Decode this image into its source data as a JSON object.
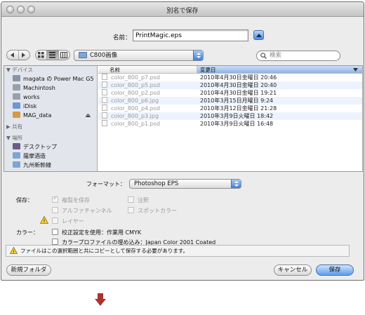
{
  "window": {
    "title": "別名で保存"
  },
  "name": {
    "label": "名前：",
    "value": "PrintMagic.eps"
  },
  "toolbar": {
    "location": "C800画像",
    "search_placeholder": "検索"
  },
  "sidebar": {
    "sections": [
      {
        "title": "デバイス",
        "items": [
          {
            "label": "magata の Power Mac G5",
            "icon": "computer-icon"
          },
          {
            "label": "Machintosh",
            "icon": "hard-drive-icon"
          },
          {
            "label": "works",
            "icon": "hard-drive-icon"
          },
          {
            "label": "iDisk",
            "icon": "idisk-icon"
          },
          {
            "label": "MAG_data",
            "icon": "disk-icon",
            "eject": "⏏"
          }
        ]
      },
      {
        "title": "共有",
        "items": []
      },
      {
        "title": "場所",
        "items": [
          {
            "label": "デスクトップ",
            "icon": "desktop-icon"
          },
          {
            "label": "薩摩酒造",
            "icon": "folder-icon"
          },
          {
            "label": "九州新幹線",
            "icon": "folder-icon"
          }
        ]
      }
    ]
  },
  "file_list": {
    "headers": {
      "name": "名前",
      "date": "変更日"
    },
    "rows": [
      {
        "name": "color_800_p7.psd",
        "date": "2010年4月30日金曜日 20:46"
      },
      {
        "name": "color_800_p5.psd",
        "date": "2010年4月30日金曜日 20:40"
      },
      {
        "name": "color_800_p2.psd",
        "date": "2010年4月30日金曜日 19:21"
      },
      {
        "name": "color_800_p6.jpg",
        "date": "2010年3月15日月曜日 9:24"
      },
      {
        "name": "color_800_p4.psd",
        "date": "2010年3月12日金曜日 21:28"
      },
      {
        "name": "color_800_p3.jpg",
        "date": "2010年3月9日火曜日 18:42"
      },
      {
        "name": "color_800_p1.psd",
        "date": "2010年3月9日火曜日 16:48"
      }
    ]
  },
  "options": {
    "format_label": "フォーマット：",
    "format_value": "Photoshop EPS",
    "save_label": "保存：",
    "as_copy": "複製を保存",
    "notes": "注釈",
    "alpha": "アルファチャンネル",
    "spot": "スポットカラー",
    "layers": "レイヤー",
    "color_label": "カラー：",
    "proof": "校正設定を使用：作業用 CMYK",
    "embed": "カラープロファイルの埋め込み：Japan Color 2001 Coated",
    "warning": "ファイルはこの選択範囲と共にコピーとして保存する必要があります。"
  },
  "buttons": {
    "new_folder": "新規フォルダ",
    "cancel": "キャンセル",
    "save": "保存"
  },
  "colors": {
    "accent": "#5d9ef0",
    "arrow": "#a8342e"
  }
}
